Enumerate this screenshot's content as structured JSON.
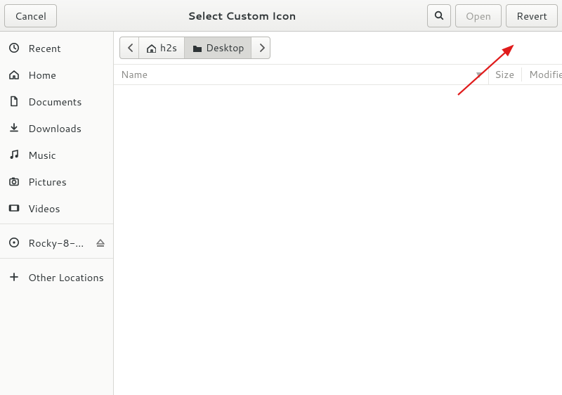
{
  "header": {
    "title": "Select Custom Icon",
    "cancel": "Cancel",
    "open": "Open",
    "revert": "Revert"
  },
  "sidebar": {
    "items": [
      {
        "icon": "clock",
        "label": "Recent"
      },
      {
        "icon": "home",
        "label": "Home"
      },
      {
        "icon": "doc",
        "label": "Documents"
      },
      {
        "icon": "download",
        "label": "Downloads"
      },
      {
        "icon": "music",
        "label": "Music"
      },
      {
        "icon": "camera",
        "label": "Pictures"
      },
      {
        "icon": "video",
        "label": "Videos"
      }
    ],
    "mounts": [
      {
        "icon": "disc",
        "label": "Rocky-8-…",
        "ejectable": true
      }
    ],
    "other": {
      "icon": "plus",
      "label": "Other Locations"
    }
  },
  "breadcrumb": {
    "segments": [
      {
        "icon": "home",
        "label": "h2s",
        "active": false
      },
      {
        "icon": "folder",
        "label": "Desktop",
        "active": true
      }
    ]
  },
  "columns": {
    "name": "Name",
    "size": "Size",
    "modified": "Modified"
  }
}
